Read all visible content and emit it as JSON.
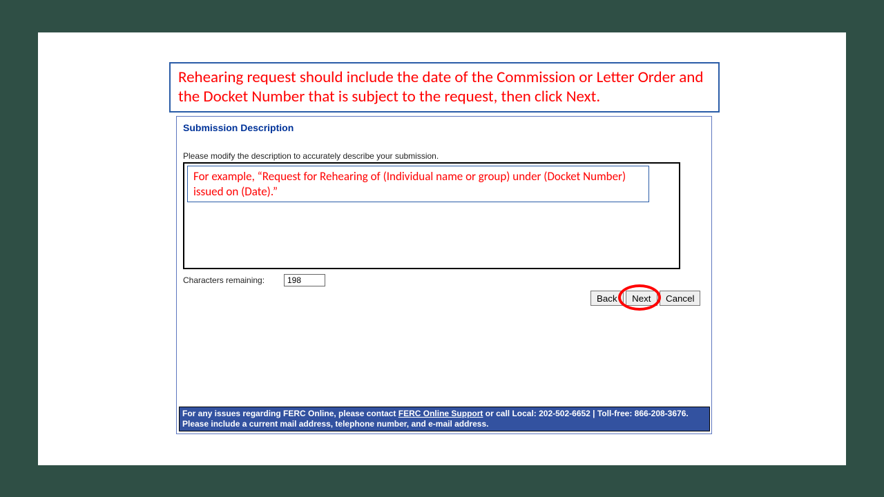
{
  "callout": {
    "text": "Rehearing request should include the date of the Commission or Letter Order and the Docket Number that is subject to the request, then click Next."
  },
  "panel": {
    "title": "Submission Description",
    "instruction": "Please modify the description to accurately describe your submission.",
    "textarea_value": "",
    "example_text": "For example, “Request for Rehearing  of (Individual  name or group) under (Docket  Number)  issued on (Date).”",
    "chars_label": "Characters remaining:",
    "chars_value": "198"
  },
  "buttons": {
    "back": "Back",
    "next": "Next",
    "cancel": "Cancel"
  },
  "support": {
    "prefix": "For any issues regarding FERC Online, please contact ",
    "link": "FERC Online Support",
    "suffix": " or call Local: 202-502-6652 | Toll-free: 866-208-3676. Please include a current mail address, telephone number, and e-mail address."
  }
}
